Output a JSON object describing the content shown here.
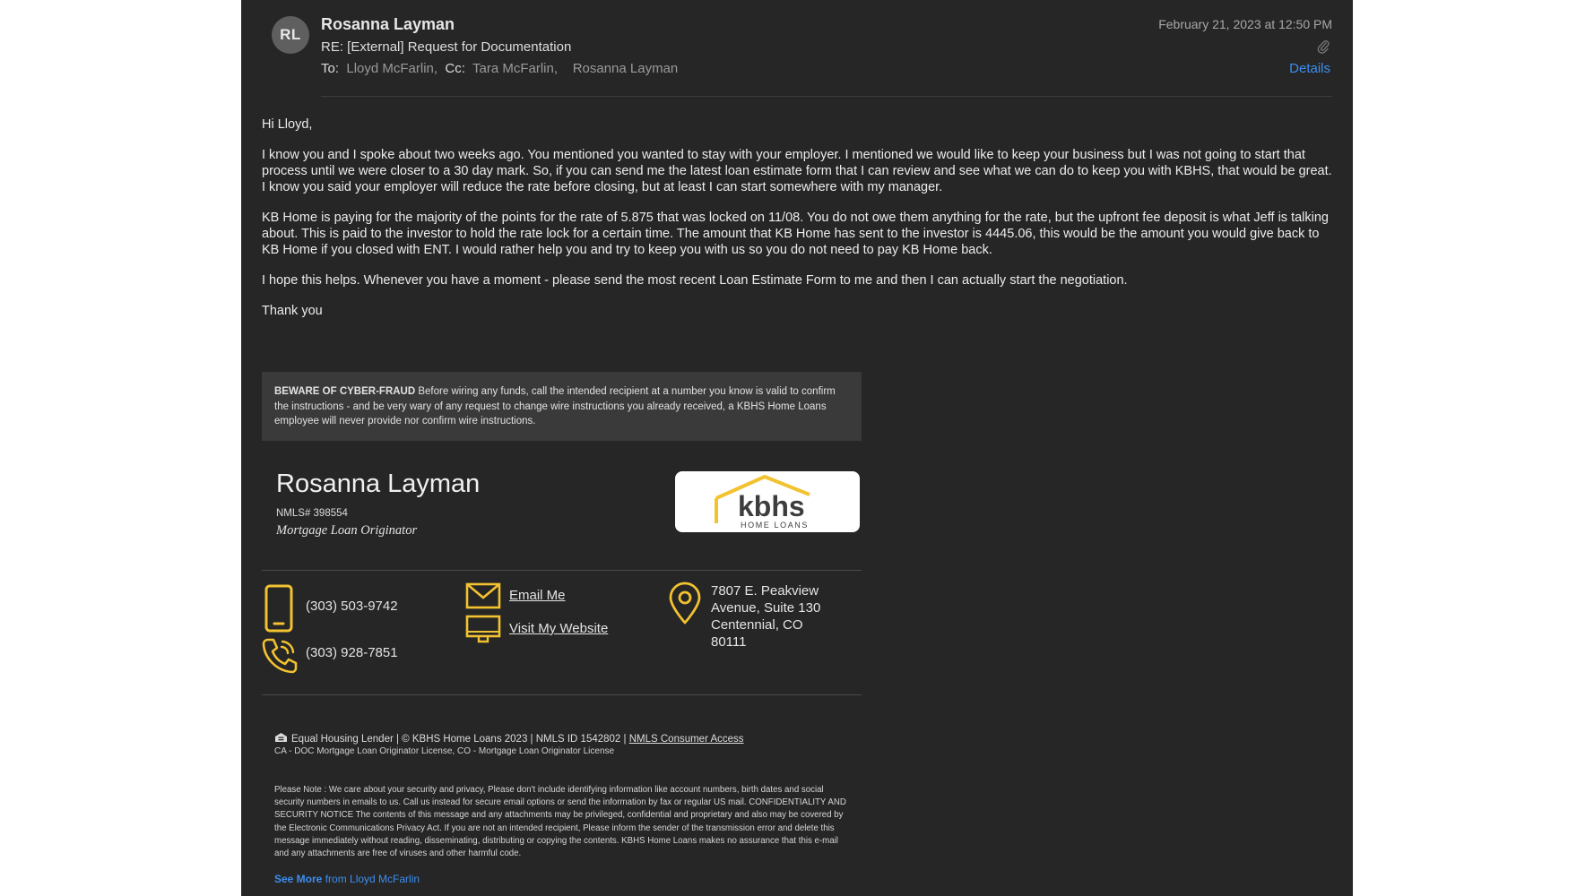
{
  "header": {
    "avatar_initials": "RL",
    "sender": "Rosanna Layman",
    "subject": "RE: [External] Request for Documentation",
    "to_label": "To:",
    "to": "Lloyd McFarlin,",
    "cc_label": "Cc:",
    "cc_1": "Tara McFarlin,",
    "cc_2": "Rosanna Layman",
    "date": "February 21, 2023 at 12:50 PM",
    "details_label": "Details"
  },
  "body": {
    "greeting": "Hi Lloyd,",
    "p1": "I know you and I spoke about two weeks ago. You mentioned you wanted to stay with your employer. I mentioned we would like to keep your business but I was not going to start that process until we were closer to a 30 day mark. So, if you can send me the latest loan estimate form that I can review and see what we can do to keep you with KBHS, that would be great. I know you said your employer will reduce the rate before closing, but at least I can start somewhere with my manager.",
    "p2": "KB Home is paying for the majority of the points for the rate of 5.875 that was locked on 11/08. You do not owe them anything for the rate, but the upfront fee deposit is what Jeff is talking about. This is paid to the investor to hold the rate lock for a certain time. The amount that KB Home has sent to the investor is 4445.06, this would be the amount you would give back to KB Home if you closed with ENT. I would rather help you and try to keep you with us so you do not need to pay KB Home back.",
    "p3": "I hope this helps. Whenever you have a moment - please send the most recent Loan Estimate Form to me and then I can actually start the negotiation.",
    "closing": "Thank you"
  },
  "fraud_notice": {
    "heading": "BEWARE OF CYBER-FRAUD",
    "text": " Before wiring any funds, call the intended recipient at a number you know is valid to confirm the instructions - and be very wary of any request to change wire instructions you already received, a KBHS Home Loans employee will never provide nor confirm wire instructions."
  },
  "signature": {
    "name": "Rosanna Layman",
    "nmls": "NMLS# 398554",
    "title": "Mortgage Loan Originator",
    "logo_text": "kbhs",
    "logo_subtext": "HOME LOANS",
    "mobile": "(303) 503-9742",
    "phone": "(303) 928-7851",
    "email_label": "Email Me",
    "website_label": "Visit My Website",
    "address_line1": "7807 E. Peakview",
    "address_line2": "Avenue, Suite 130",
    "address_line3": "Centennial, CO",
    "address_line4": "80111",
    "accent_color": "#f2c230"
  },
  "footer": {
    "equal_housing": "Equal Housing Lender | © KBHS Home Loans 2023 | NMLS ID 1542802 | ",
    "nmls_access": "NMLS Consumer Access",
    "license": "CA - DOC Mortgage Loan Originator License, CO - Mortgage Loan Originator License",
    "notice": "Please Note : We care about your security and privacy, Please don't include identifying information like account numbers, birth dates and social security numbers in emails to us. Call us instead for secure email options or send the information by fax or regular US mail. CONFIDENTIALITY AND SECURITY NOTICE The contents of this message and any attachments may be privileged, confidential and proprietary and also may be covered by the Electronic Communications Privacy Act. If you are not an intended recipient, Please inform the sender of the transmission error and delete this message immediately without reading, disseminating, distributing or copying the contents. KBHS Home Loans makes no assurance that this e-mail and any attachments are free of viruses and other harmful code.",
    "see_more": "See More",
    "see_more_from": " from Lloyd McFarlin"
  }
}
